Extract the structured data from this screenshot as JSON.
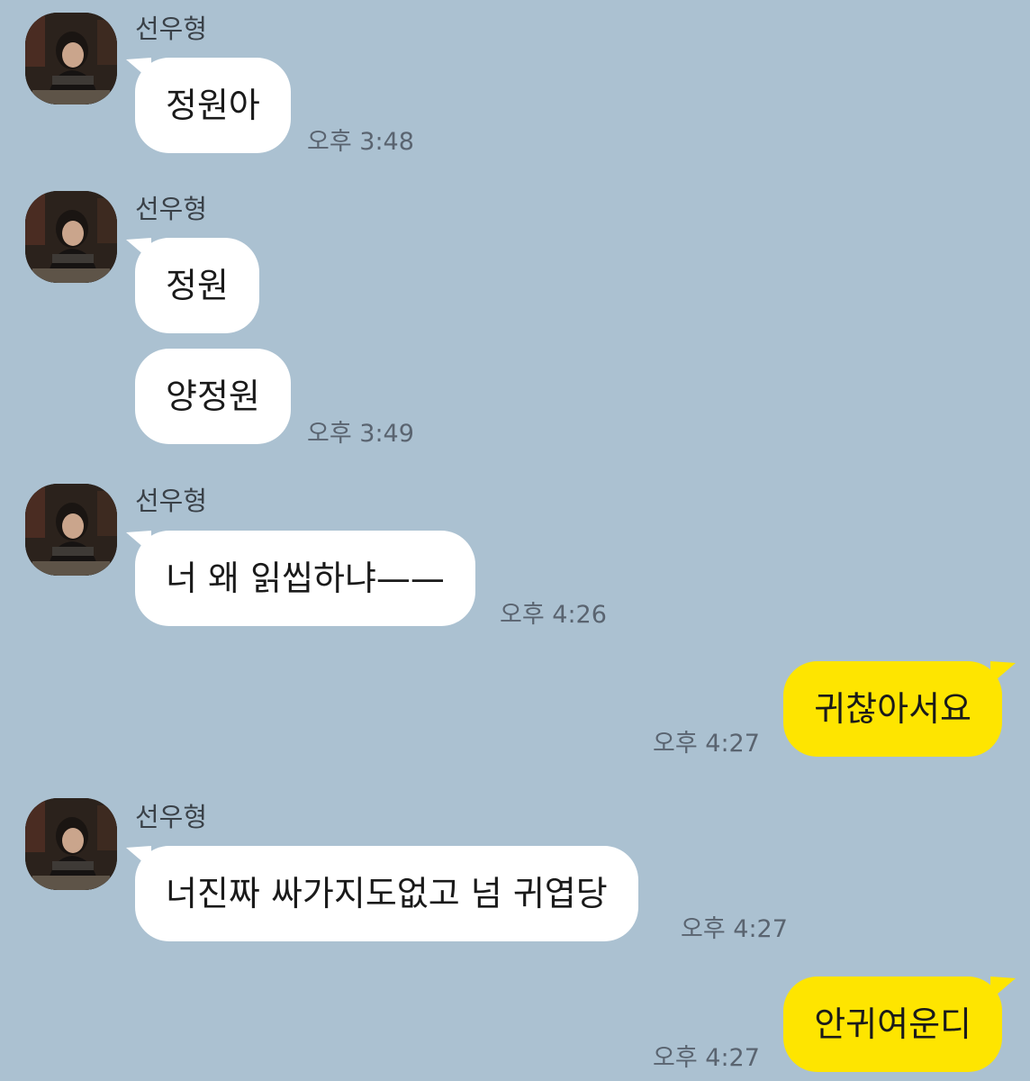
{
  "chat": {
    "sender_name": "선우형",
    "messages": [
      {
        "text": "정원아",
        "time": "오후 3:48"
      },
      {
        "text": "정원"
      },
      {
        "text": "양정원",
        "time": "오후 3:49"
      },
      {
        "text": "너 왜 읽씹하냐——",
        "time": "오후 4:26"
      },
      {
        "text": "귀찮아서요",
        "time": "오후 4:27"
      },
      {
        "text": "너진짜 싸가지도없고 넘 귀엽당",
        "time": "오후 4:27"
      },
      {
        "text": "안귀여운디",
        "time": "오후 4:27"
      }
    ]
  },
  "colors": {
    "background": "#abc1d1",
    "incoming_bubble": "#ffffff",
    "outgoing_bubble": "#fee500"
  }
}
